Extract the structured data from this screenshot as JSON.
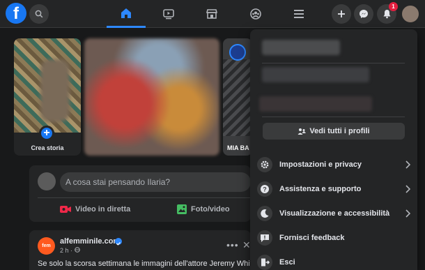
{
  "app": {
    "logo_letter": "f"
  },
  "topbar": {
    "notification_count": "1",
    "nav": [
      "home-icon",
      "video-icon",
      "marketplace-icon",
      "groups-icon",
      "menu-icon"
    ],
    "right": [
      "plus-icon",
      "messenger-icon",
      "bell-icon"
    ],
    "accent": "#2d88ff"
  },
  "stories": {
    "create_label": "Crea storia",
    "third_label": "MIA BA"
  },
  "composer": {
    "placeholder": "A cosa stai pensando Ilaria?",
    "actions": [
      {
        "label": "Video in diretta",
        "color": "#f02849"
      },
      {
        "label": "Foto/video",
        "color": "#45bd62"
      }
    ]
  },
  "post": {
    "logo_text": "fem",
    "author": "alfemminile.com",
    "time": "2 h · ",
    "text": "Se solo la scorsa settimana le immagini dell'attore Jeremy White nella"
  },
  "menu": {
    "see_all_label": "Vedi tutti i profili",
    "items": [
      {
        "label": "Impostazioni e privacy",
        "icon": "gear-icon",
        "has_chevron": true
      },
      {
        "label": "Assistenza e supporto",
        "icon": "question-icon",
        "has_chevron": true
      },
      {
        "label": "Visualizzazione e accessibilità",
        "icon": "moon-icon",
        "has_chevron": true
      },
      {
        "label": "Fornisci feedback",
        "icon": "feedback-icon",
        "has_chevron": false
      },
      {
        "label": "Esci",
        "icon": "logout-icon",
        "has_chevron": false
      }
    ]
  }
}
